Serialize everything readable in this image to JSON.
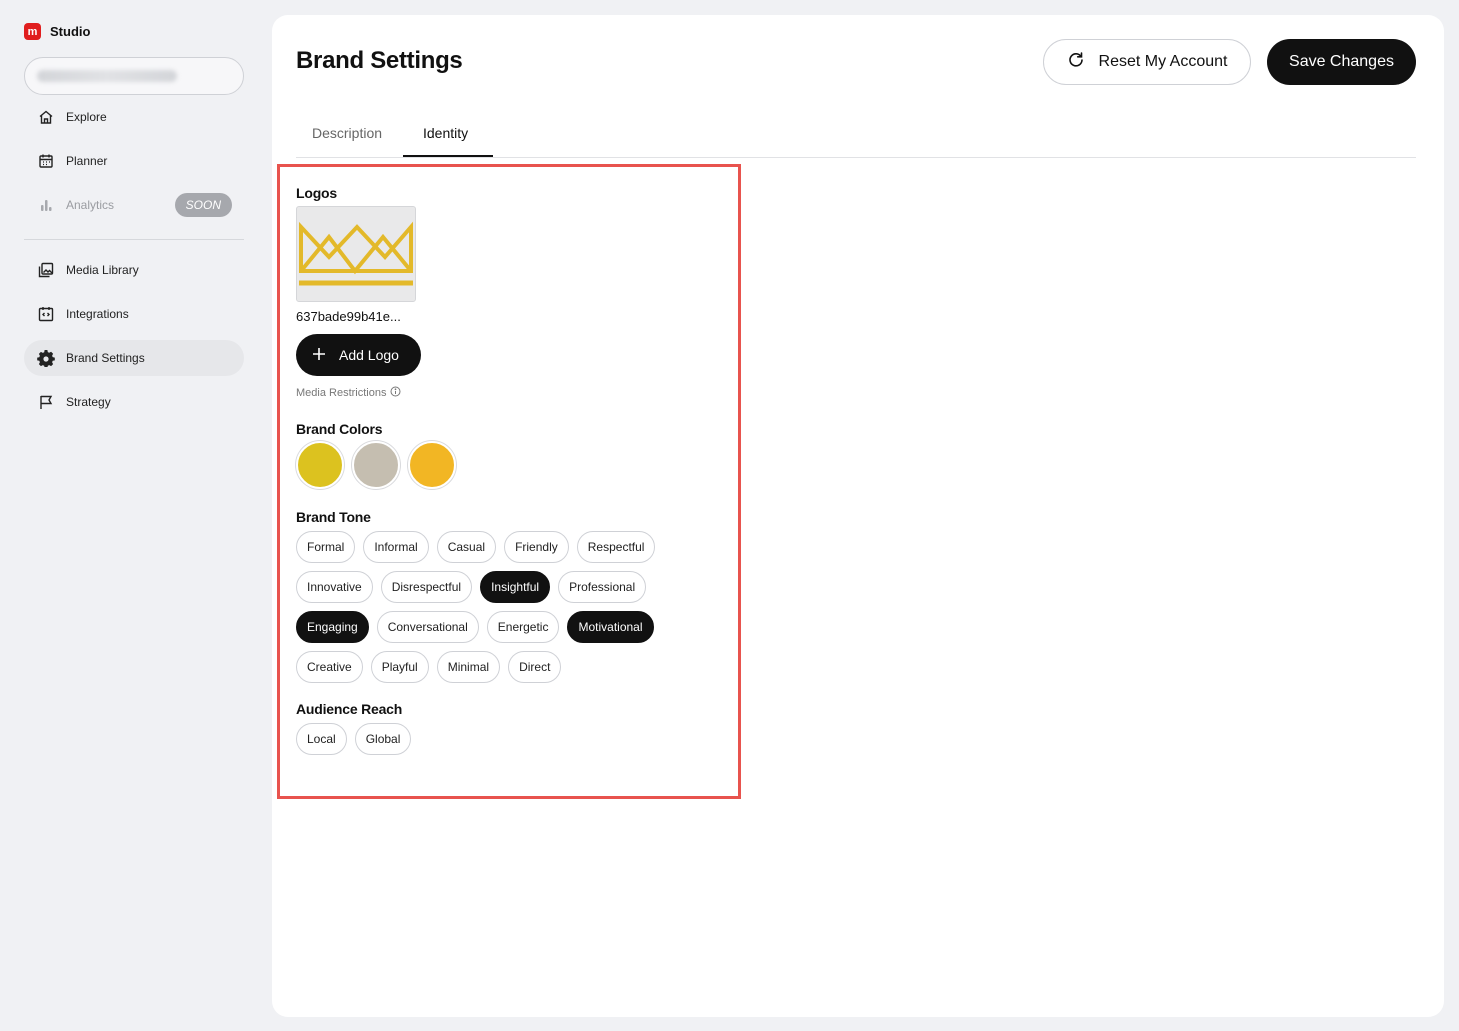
{
  "app": {
    "name": "Studio",
    "logo_letter": "m"
  },
  "sidebar": {
    "items": [
      {
        "label": "Explore",
        "icon": "home-icon"
      },
      {
        "label": "Planner",
        "icon": "calendar-icon"
      },
      {
        "label": "Analytics",
        "icon": "bar-chart-icon",
        "badge": "SOON"
      },
      {
        "label": "Media Library",
        "icon": "image-library-icon"
      },
      {
        "label": "Integrations",
        "icon": "code-icon"
      },
      {
        "label": "Brand Settings",
        "icon": "gear-icon"
      },
      {
        "label": "Strategy",
        "icon": "flag-icon"
      }
    ]
  },
  "header": {
    "title": "Brand Settings",
    "reset_label": "Reset My Account",
    "save_label": "Save Changes"
  },
  "tabs": [
    {
      "label": "Description"
    },
    {
      "label": "Identity"
    }
  ],
  "identity": {
    "logos_title": "Logos",
    "logo_filename": "637bade99b41e...",
    "add_logo_label": "Add Logo",
    "media_restrictions": "Media Restrictions",
    "colors_title": "Brand Colors",
    "colors": [
      "#dcc21f",
      "#c5beb0",
      "#f2b624"
    ],
    "tone_title": "Brand Tone",
    "tone_rows": [
      [
        {
          "label": "Formal",
          "selected": false
        },
        {
          "label": "Informal",
          "selected": false
        },
        {
          "label": "Casual",
          "selected": false
        },
        {
          "label": "Friendly",
          "selected": false
        },
        {
          "label": "Respectful",
          "selected": false
        }
      ],
      [
        {
          "label": "Innovative",
          "selected": false
        },
        {
          "label": "Disrespectful",
          "selected": false
        },
        {
          "label": "Insightful",
          "selected": true
        },
        {
          "label": "Professional",
          "selected": false
        }
      ],
      [
        {
          "label": "Engaging",
          "selected": true
        },
        {
          "label": "Conversational",
          "selected": false
        },
        {
          "label": "Energetic",
          "selected": false
        },
        {
          "label": "Motivational",
          "selected": true
        }
      ],
      [
        {
          "label": "Creative",
          "selected": false
        },
        {
          "label": "Playful",
          "selected": false
        },
        {
          "label": "Minimal",
          "selected": false
        },
        {
          "label": "Direct",
          "selected": false
        }
      ]
    ],
    "reach_title": "Audience Reach",
    "reach_options": [
      {
        "label": "Local",
        "selected": false
      },
      {
        "label": "Global",
        "selected": false
      }
    ]
  }
}
